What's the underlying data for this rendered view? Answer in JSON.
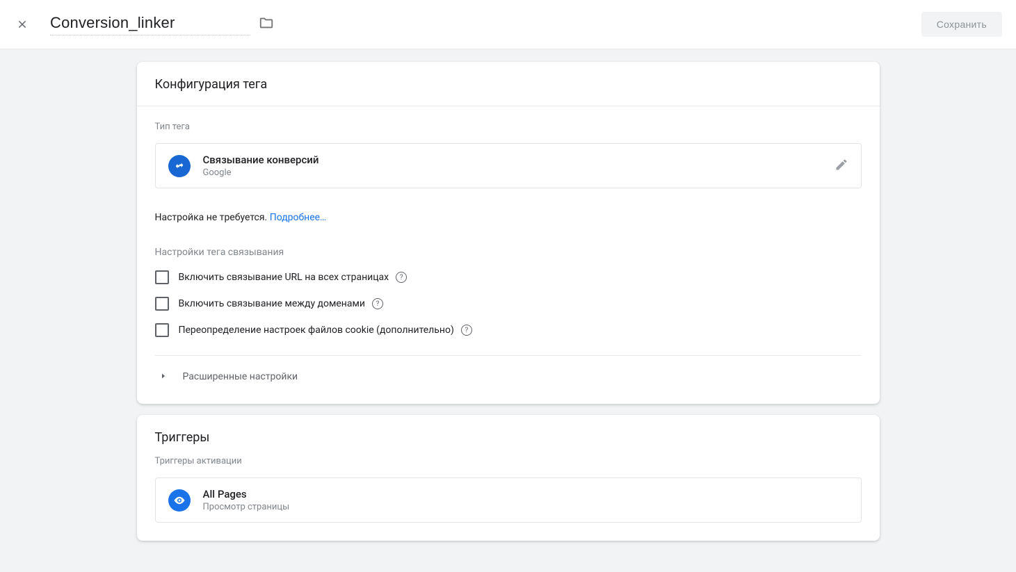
{
  "header": {
    "title": "Conversion_linker",
    "save_label": "Сохранить"
  },
  "tag_config": {
    "card_title": "Конфигурация тега",
    "type_label": "Тип тега",
    "type_name": "Связывание конверсий",
    "type_vendor": "Google",
    "info_text": "Настройка не требуется. ",
    "info_link": "Подробнее…",
    "linker_heading": "Настройки тега связывания",
    "options": [
      "Включить связывание URL на всех страницах",
      "Включить связывание между доменами",
      "Переопределение настроек файлов cookie (дополнительно)"
    ],
    "advanced_label": "Расширенные настройки"
  },
  "triggers": {
    "card_title": "Триггеры",
    "activation_label": "Триггеры активации",
    "trigger_name": "All Pages",
    "trigger_type": "Просмотр страницы"
  }
}
